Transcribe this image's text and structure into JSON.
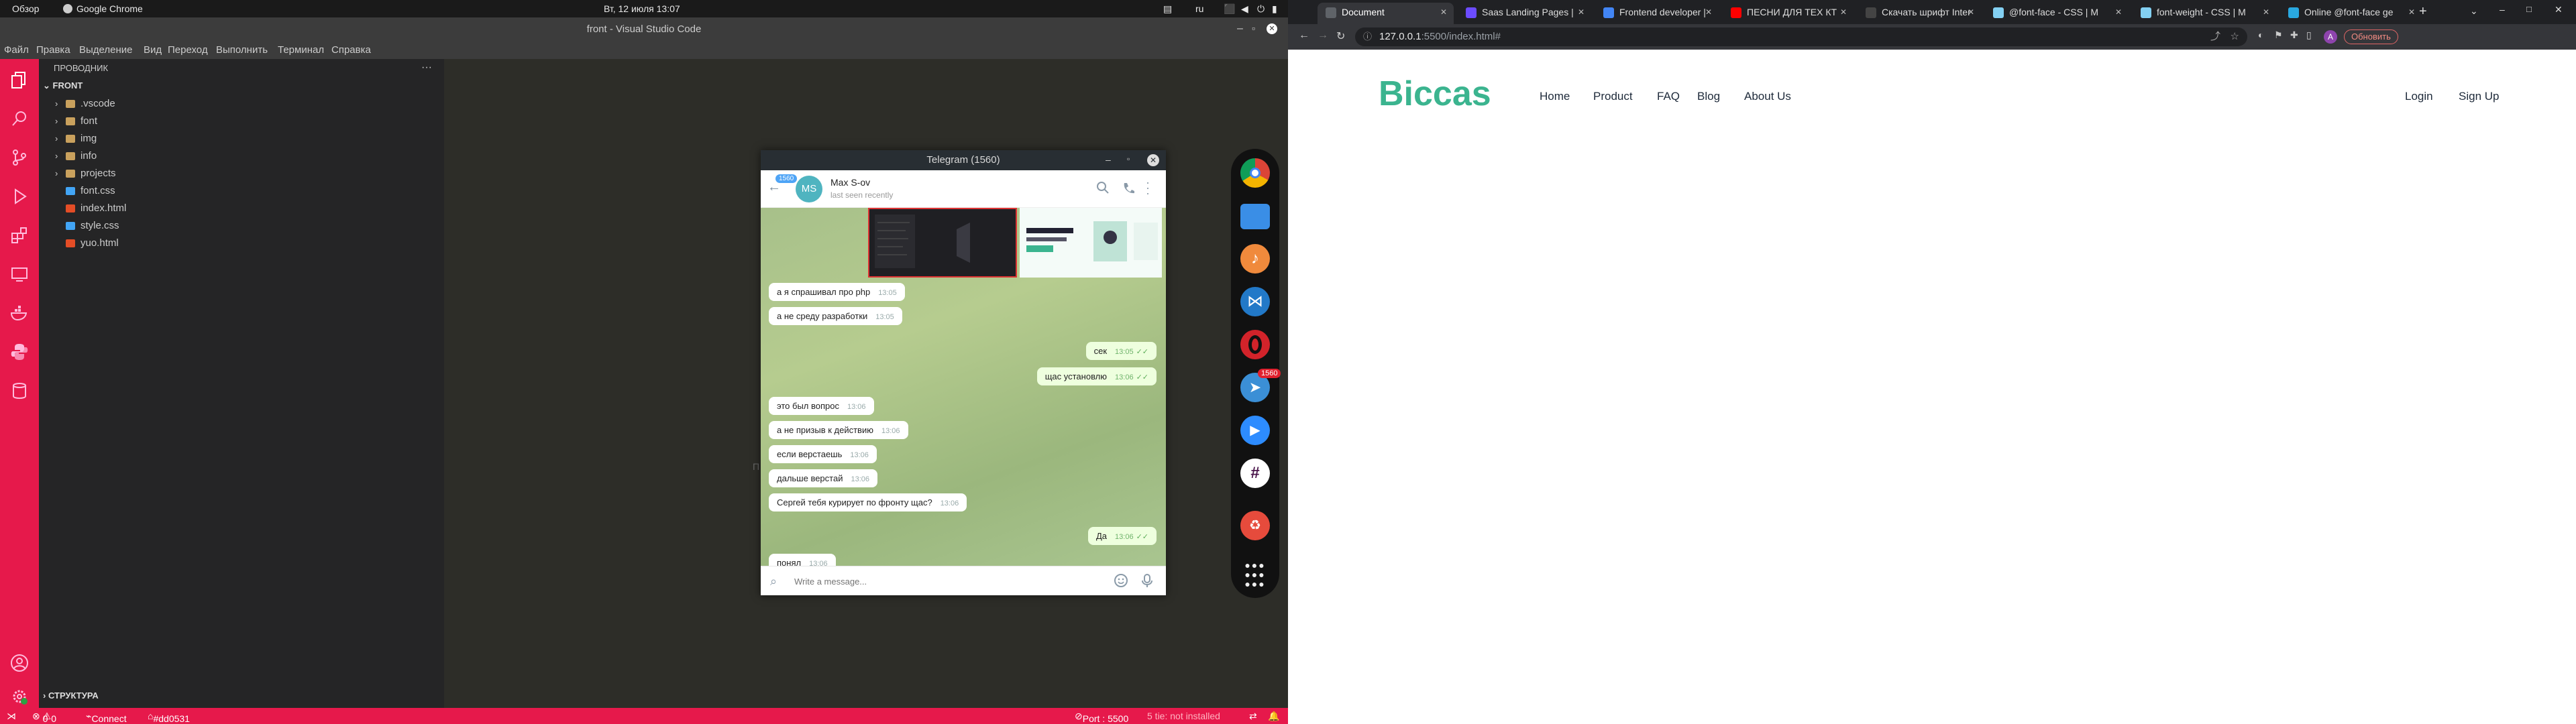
{
  "system": {
    "overview": "Обзор",
    "app_name": "Google Chrome",
    "datetime": "Вт, 12 июля  13:07",
    "lang": "ru"
  },
  "vscode": {
    "title": "front - Visual Studio Code",
    "menu": [
      "Файл",
      "Правка",
      "Выделение",
      "Вид",
      "Переход",
      "Выполнить",
      "Терминал",
      "Справка"
    ],
    "explorer_title": "ПРОВОДНИК",
    "root_folder": "FRONT",
    "tree": [
      {
        "name": ".vscode",
        "type": "folder"
      },
      {
        "name": "font",
        "type": "folder"
      },
      {
        "name": "img",
        "type": "folder"
      },
      {
        "name": "info",
        "type": "folder"
      },
      {
        "name": "projects",
        "type": "folder"
      },
      {
        "name": "font.css",
        "type": "css"
      },
      {
        "name": "index.html",
        "type": "html"
      },
      {
        "name": "style.css",
        "type": "css"
      },
      {
        "name": "yuo.html",
        "type": "html"
      }
    ],
    "outline": "СТРУКТУРА",
    "status": {
      "errors": "0",
      "warnings": "0",
      "connect": "Connect",
      "color": "#dd0531",
      "port": "Port : 5500",
      "note": "5 tie: not installed"
    },
    "accent": "#e6194b"
  },
  "telegram": {
    "window_title": "Telegram (1560)",
    "badge": "1560",
    "contact_initials": "MS",
    "contact_name": "Max S-ov",
    "contact_status": "last seen recently",
    "messages": [
      {
        "dir": "in",
        "text": "а я спрашивал про php",
        "time": "13:05"
      },
      {
        "dir": "in",
        "text": "а не среду разработки",
        "time": "13:05"
      },
      {
        "dir": "out",
        "text": "сек",
        "time": "13:05"
      },
      {
        "dir": "out",
        "text": "щас установлю",
        "time": "13:06"
      },
      {
        "dir": "in",
        "text": "это был вопрос",
        "time": "13:06"
      },
      {
        "dir": "in",
        "text": "а не призыв к действию",
        "time": "13:06"
      },
      {
        "dir": "in",
        "text": "если верстаешь",
        "time": "13:06"
      },
      {
        "dir": "in",
        "text": "дальше верстай",
        "time": "13:06"
      },
      {
        "dir": "in",
        "text": "Сергей тебя курирует по фронту щас?",
        "time": "13:06"
      },
      {
        "dir": "out",
        "text": "Да",
        "time": "13:06"
      },
      {
        "dir": "in",
        "text": "понял",
        "time": "13:06"
      }
    ],
    "input_placeholder": "Write a message..."
  },
  "dock": {
    "badge": "1560",
    "apps": [
      "chrome-icon",
      "folder-icon",
      "music-icon",
      "vscode-icon",
      "opera-icon",
      "telegram-icon",
      "zoom-icon",
      "slack-icon",
      "trash-icon",
      "apps-grid-icon"
    ]
  },
  "chrome": {
    "tabs": [
      {
        "title": "Document",
        "active": true,
        "color": "#5f6368"
      },
      {
        "title": "Saas Landing Pages |",
        "active": false,
        "color": "#6c4cff"
      },
      {
        "title": "Frontend developer |",
        "active": false,
        "color": "#4285f4"
      },
      {
        "title": "ПЕСНИ ДЛЯ ТЕХ КТ",
        "active": false,
        "color": "#ff0000"
      },
      {
        "title": "Скачать шрифт Inter",
        "active": false,
        "color": "#444"
      },
      {
        "title": "@font-face - CSS | M",
        "active": false,
        "color": "#83d0f2"
      },
      {
        "title": "font-weight - CSS | M",
        "active": false,
        "color": "#83d0f2"
      },
      {
        "title": "Online @font-face ge",
        "active": false,
        "color": "#29a8e0"
      }
    ],
    "url_host": "127.0.0.1",
    "url_path": ":5500/index.html#",
    "update_label": "Обновить",
    "profile_initial": "A"
  },
  "site": {
    "logo": "Biccas",
    "nav": [
      "Home",
      "Product",
      "FAQ",
      "Blog",
      "About Us"
    ],
    "login": "Login",
    "signup": "Sign Up",
    "brand_color": "#3bb48f"
  }
}
